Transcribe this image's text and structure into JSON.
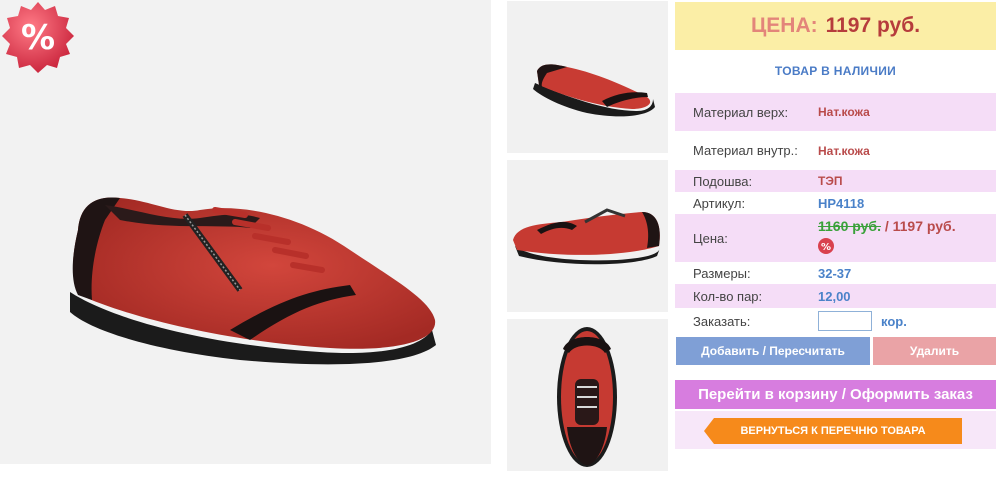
{
  "badge": {
    "symbol": "%",
    "icon": "percent-sale-badge",
    "color": "#d9414e"
  },
  "price_box": {
    "label": "ЦЕНА:",
    "value": "1197 руб."
  },
  "stock_status": "ТОВАР В НАЛИЧИИ",
  "specs": {
    "material_top": {
      "key": "Материал верх:",
      "value": "Нат.кожа"
    },
    "material_inner": {
      "key": "Материал внутр.:",
      "value": "Нат.кожа"
    },
    "sole": {
      "key": "Подошва:",
      "value": "ТЭП"
    },
    "article": {
      "key": "Артикул:",
      "value": "НР4118"
    },
    "price": {
      "key": "Цена:",
      "old": "1160 руб.",
      "sep": " / ",
      "new": "1197 руб."
    },
    "sizes": {
      "key": "Размеры:",
      "value": "32-37"
    },
    "pairs": {
      "key": "Кол-во пар:",
      "value": "12,00"
    },
    "order": {
      "key": "Заказать:",
      "value": "",
      "unit": "кор."
    }
  },
  "buttons": {
    "add": "Добавить / Пересчитать",
    "delete": "Удалить",
    "cart": "Перейти в корзину / Оформить заказ",
    "back": "ВЕРНУТЬСЯ К ПЕРЕЧНЮ ТОВАРА"
  },
  "colors": {
    "accent_pink": "#d77ddf",
    "accent_orange": "#f68a1b",
    "accent_blue": "#7f9fd6",
    "price_red": "#b63c3c"
  }
}
